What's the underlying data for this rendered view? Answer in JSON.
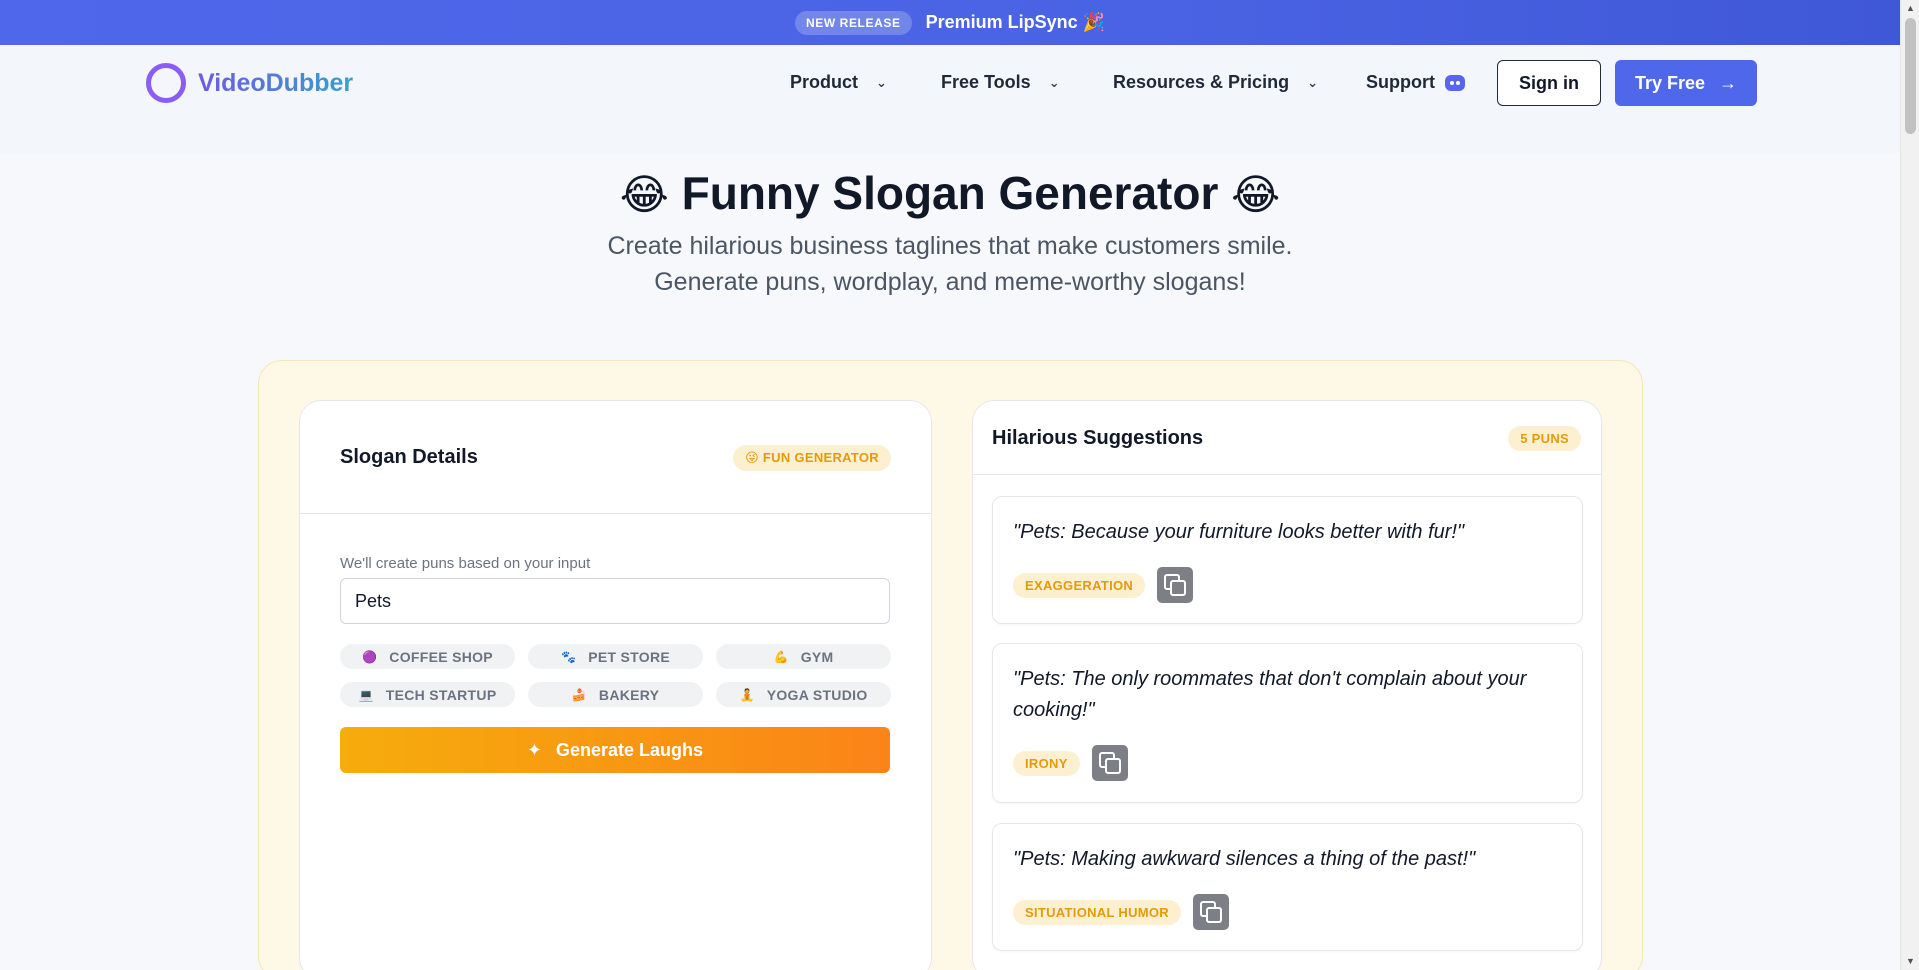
{
  "announcement": {
    "badge": "NEW RELEASE",
    "message": "Premium LipSync 🎉"
  },
  "brand": {
    "name": "VideoDubber"
  },
  "nav": {
    "items": [
      {
        "label": "Product",
        "has_dropdown": true
      },
      {
        "label": "Free Tools",
        "has_dropdown": true
      },
      {
        "label": "Resources & Pricing",
        "has_dropdown": true
      },
      {
        "label": "Support",
        "has_dropdown": false
      }
    ],
    "sign_in": "Sign in",
    "try_free": "Try Free"
  },
  "hero": {
    "emoji": "😂",
    "title": "Funny Slogan Generator",
    "subtitle_line1": "Create hilarious business taglines that make customers smile.",
    "subtitle_line2": "Generate puns, wordplay, and meme-worthy slogans!"
  },
  "details": {
    "title": "Slogan Details",
    "badge": "😜 FUN GENERATOR",
    "input_label": "We'll create puns based on your input",
    "input_value": "Pets",
    "chips": [
      {
        "icon": "🟣",
        "label": "COFFEE SHOP"
      },
      {
        "icon": "🐾",
        "label": "PET STORE"
      },
      {
        "icon": "💪",
        "label": "GYM"
      },
      {
        "icon": "💻",
        "label": "TECH STARTUP"
      },
      {
        "icon": "🍰",
        "label": "BAKERY"
      },
      {
        "icon": "🧘",
        "label": "YOGA STUDIO"
      }
    ],
    "generate_label": "Generate Laughs"
  },
  "suggestions": {
    "title": "Hilarious Suggestions",
    "badge": "5 PUNS",
    "items": [
      {
        "text": "\"Pets: Because your furniture looks better with fur!\"",
        "tag": "EXAGGERATION"
      },
      {
        "text": "\"Pets: The only roommates that don't complain about your cooking!\"",
        "tag": "IRONY"
      },
      {
        "text": "\"Pets: Making awkward silences a thing of the past!\"",
        "tag": "SITUATIONAL HUMOR"
      }
    ]
  },
  "colors": {
    "accent": "#4f67ea",
    "warm": "#f6ac0c",
    "tag_text": "#e69a0a",
    "tag_bg": "#fdf0d0"
  }
}
